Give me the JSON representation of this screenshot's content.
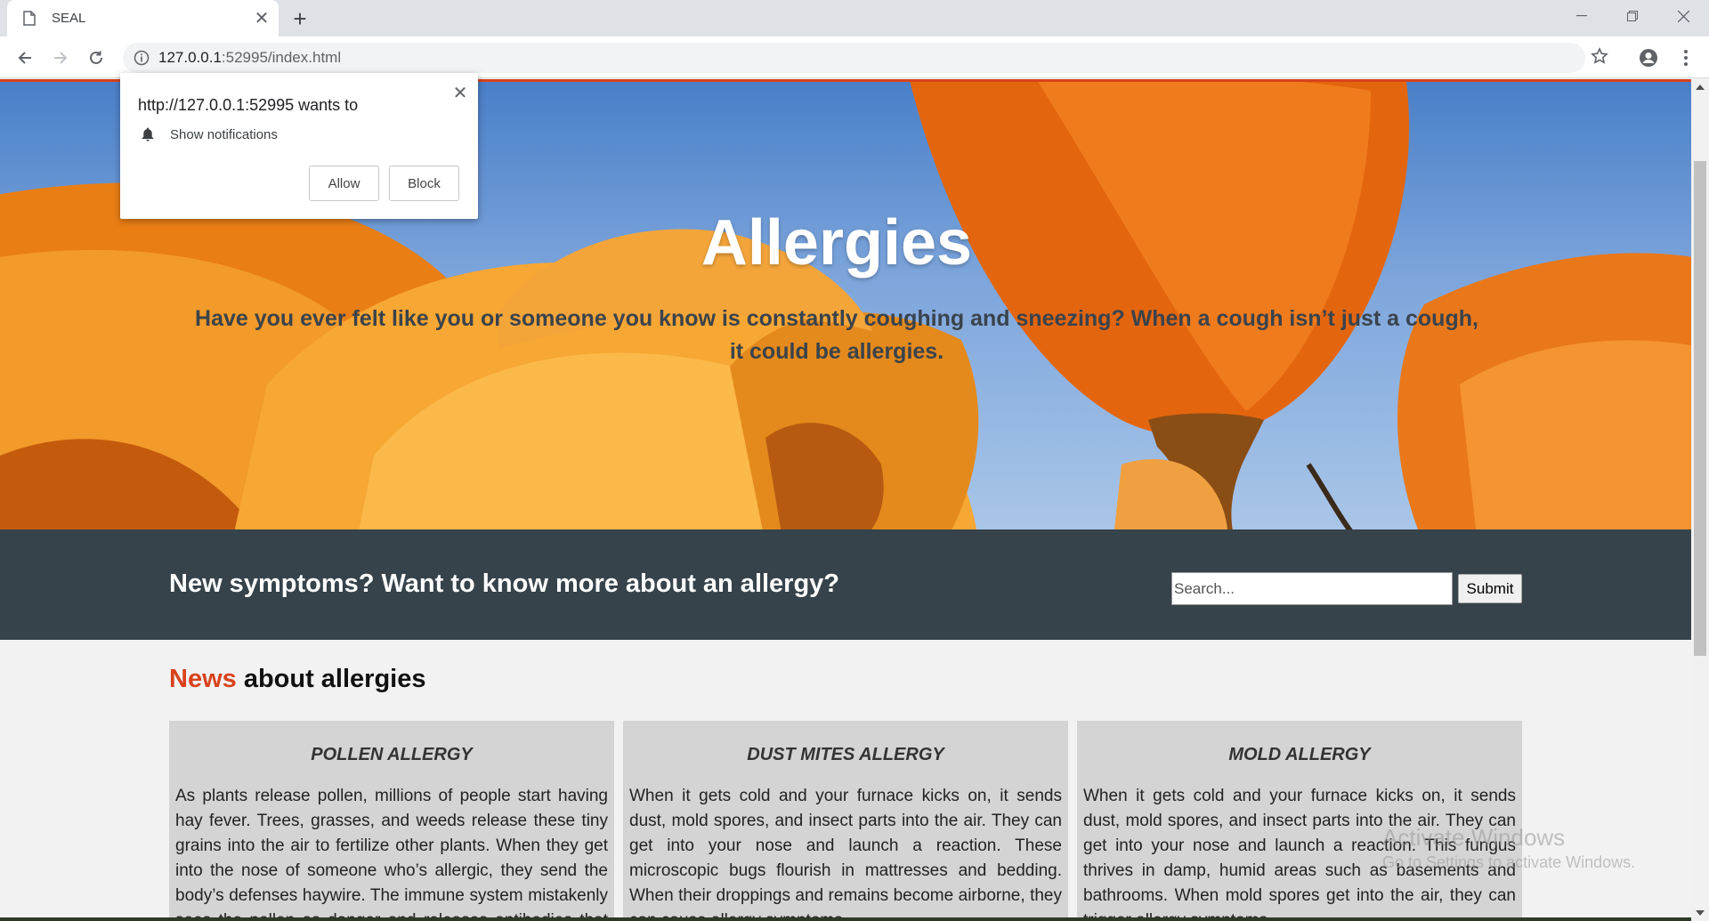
{
  "browser": {
    "tab_title": "SEAL",
    "url_host": "127.0.0.1",
    "url_rest": ":52995/index.html"
  },
  "notification_popup": {
    "message": "http://127.0.0.1:52995 wants to",
    "permission": "Show notifications",
    "allow_label": "Allow",
    "block_label": "Block"
  },
  "hero": {
    "title": "Allergies",
    "subtitle": "Have you ever felt like you or someone you know is constantly coughing and sneezing? When a cough isn’t just a cough, it could be allergies."
  },
  "cta": {
    "text": "New symptoms? Want to know more about an allergy?",
    "search_placeholder": "Search...",
    "submit_label": "Submit"
  },
  "news": {
    "accent": "News",
    "rest": " about allergies",
    "cards": [
      {
        "title": "POLLEN ALLERGY",
        "body": "As plants release pollen, millions of people start having hay fever. Trees, grasses, and weeds release these tiny grains into the air to fertilize other plants. When they get into the nose of someone who’s allergic, they send the body’s defenses haywire. The immune system mistakenly sees the pollen as danger and releases antibodies that attack the allergens."
      },
      {
        "title": "DUST MITES ALLERGY",
        "body": "When it gets cold and your furnace kicks on, it sends dust, mold spores, and insect parts into the air. They can get into your nose and launch a reaction. These microscopic bugs flourish in mattresses and bedding. When their droppings and remains become airborne, they can cause allergy symptoms."
      },
      {
        "title": "MOLD ALLERGY",
        "body": "When it gets cold and your furnace kicks on, it sends dust, mold spores, and insect parts into the air. They can get into your nose and launch a reaction. This fungus thrives in damp, humid areas such as basements and bathrooms. When mold spores get into the air, they can trigger allergy symptoms."
      }
    ]
  },
  "watermark": {
    "line1": "Activate Windows",
    "line2": "Go to Settings to activate Windows."
  },
  "colors": {
    "accent": "#d9421b",
    "cta_bg": "#37434b",
    "card_bg": "#d4d4d4"
  }
}
